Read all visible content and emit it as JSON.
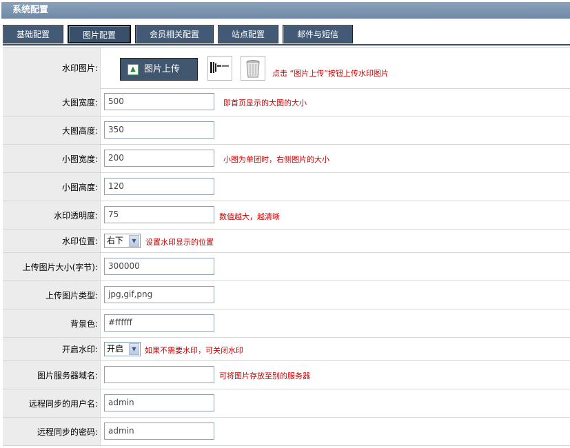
{
  "window": {
    "title": "系统配置"
  },
  "tabs": [
    {
      "label": "基础配置"
    },
    {
      "label": "图片配置"
    },
    {
      "label": "会员相关配置"
    },
    {
      "label": "站点配置"
    },
    {
      "label": "邮件与短信"
    }
  ],
  "watermark_image": {
    "label": "水印图片:",
    "upload_label": "图片上传",
    "hint": "点击 “图片上传”按钮上传水印图片"
  },
  "fields": {
    "big_width": {
      "label": "大图宽度:",
      "value": "500",
      "hint": "即首页显示的大图的大小"
    },
    "big_height": {
      "label": "大图高度:",
      "value": "350"
    },
    "small_width": {
      "label": "小图宽度:",
      "value": "200",
      "hint": "小图为单团时，右侧图片的大小"
    },
    "small_height": {
      "label": "小图高度:",
      "value": "120"
    },
    "wm_opacity": {
      "label": "水印透明度:",
      "value": "75",
      "hint": "数值越大，越清晰"
    },
    "wm_position": {
      "label": "水印位置:",
      "value": "右下",
      "hint": "设置水印显示的位置"
    },
    "upload_size": {
      "label": "上传图片大小(字节):",
      "value": "300000"
    },
    "upload_types": {
      "label": "上传图片类型:",
      "value": "jpg,gif,png"
    },
    "bg_color": {
      "label": "背景色:",
      "value": "#ffffff"
    },
    "wm_enable": {
      "label": "开启水印:",
      "value": "开启",
      "hint": "如果不需要水印，可关闭水印"
    },
    "img_server": {
      "label": "图片服务器域名:",
      "value": "",
      "hint": "可将图片存放至别的服务器"
    },
    "sync_user": {
      "label": "远程同步的用户名:",
      "value": "admin"
    },
    "sync_pass": {
      "label": "远程同步的密码:",
      "value": "admin"
    }
  }
}
